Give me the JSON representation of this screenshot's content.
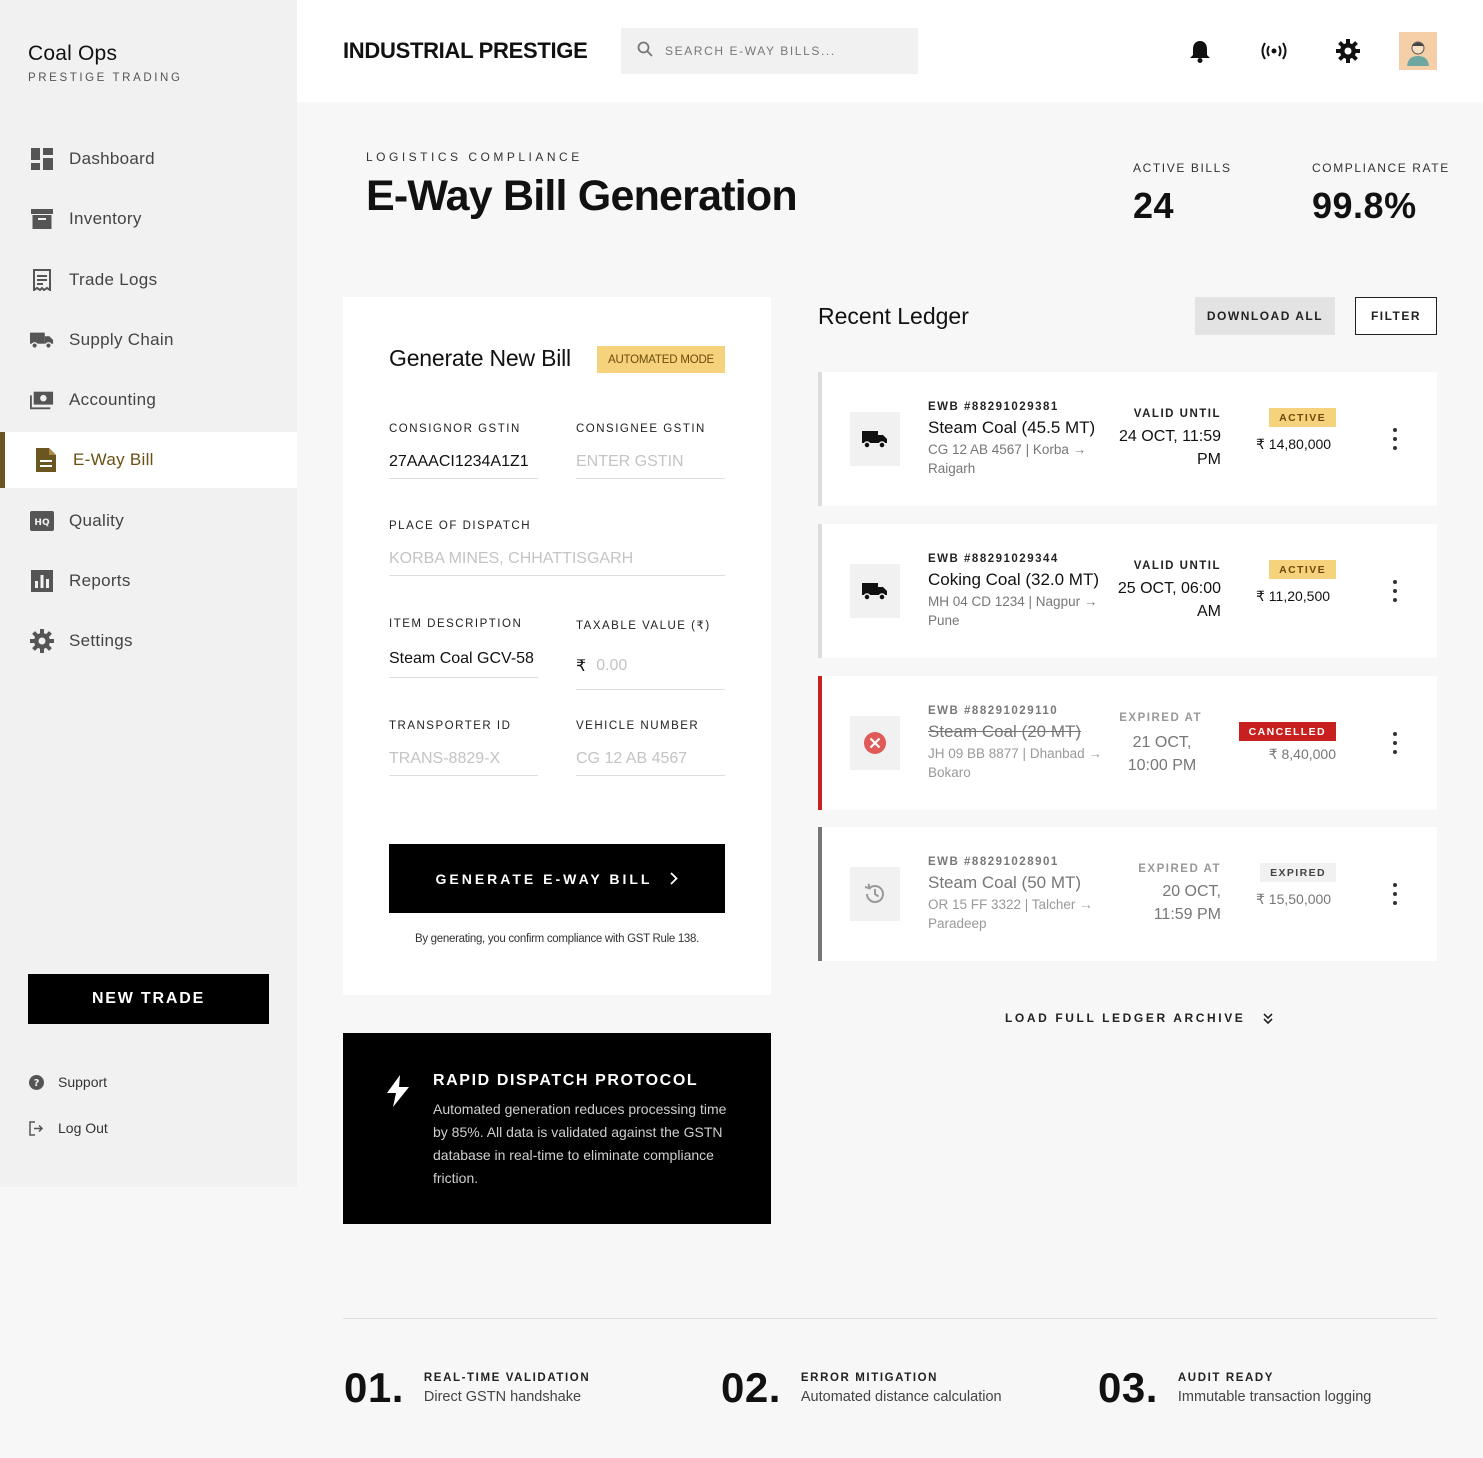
{
  "sidebar": {
    "brand_name": "Coal Ops",
    "brand_sub": "PRESTIGE TRADING",
    "items": [
      {
        "label": "Dashboard",
        "icon": "dashboard-icon"
      },
      {
        "label": "Inventory",
        "icon": "archive-icon"
      },
      {
        "label": "Trade Logs",
        "icon": "receipt-icon"
      },
      {
        "label": "Supply Chain",
        "icon": "truck-icon"
      },
      {
        "label": "Accounting",
        "icon": "cash-icon"
      },
      {
        "label": "E-Way Bill",
        "icon": "document-icon",
        "active": true
      },
      {
        "label": "Quality",
        "icon": "hq-icon"
      },
      {
        "label": "Reports",
        "icon": "bar-chart-icon"
      },
      {
        "label": "Settings",
        "icon": "gear-icon"
      }
    ],
    "new_trade": "NEW TRADE",
    "support": "Support",
    "logout": "Log Out"
  },
  "header": {
    "title": "INDUSTRIAL PRESTIGE",
    "search_placeholder": "SEARCH E-WAY BILLS..."
  },
  "page": {
    "eyebrow": "LOGISTICS COMPLIANCE",
    "title": "E-Way Bill Generation",
    "stats": [
      {
        "label": "ACTIVE BILLS",
        "value": "24"
      },
      {
        "label": "COMPLIANCE RATE",
        "value": "99.8%"
      }
    ]
  },
  "form": {
    "title": "Generate New Bill",
    "mode_badge": "AUTOMATED MODE",
    "consignor_label": "CONSIGNOR GSTIN",
    "consignor_value": "27AAACI1234A1Z1",
    "consignee_label": "CONSIGNEE GSTIN",
    "consignee_placeholder": "ENTER GSTIN",
    "dispatch_label": "PLACE OF DISPATCH",
    "dispatch_placeholder": "KORBA MINES, CHHATTISGARH",
    "item_label": "ITEM DESCRIPTION",
    "item_value": "Steam Coal GCV-58",
    "taxable_label": "TAXABLE VALUE (₹)",
    "taxable_symbol": "₹",
    "taxable_placeholder": "0.00",
    "transporter_label": "TRANSPORTER ID",
    "transporter_placeholder": "TRANS-8829-X",
    "vehicle_label": "VEHICLE NUMBER",
    "vehicle_placeholder": "CG 12 AB 4567",
    "generate_label": "GENERATE E-WAY BILL",
    "fine_print": "By generating, you confirm compliance with GST Rule 138."
  },
  "protocol": {
    "title": "RAPID DISPATCH PROTOCOL",
    "body": "Automated generation reduces processing time by 85%. All data is validated against the GSTN database in real-time to eliminate compliance friction."
  },
  "ledger": {
    "title": "Recent Ledger",
    "download_all": "DOWNLOAD ALL",
    "filter": "FILTER",
    "rows": [
      {
        "ewb": "EWB #88291029381",
        "item": "Steam Coal (45.5 MT)",
        "route": "CG 12 AB 4567 | Korba → Raigarh",
        "time_label": "VALID UNTIL",
        "time": "24 OCT, 11:59 PM",
        "status": "ACTIVE",
        "amount": "₹ 14,80,000",
        "icon": "truck-icon"
      },
      {
        "ewb": "EWB #88291029344",
        "item": "Coking Coal (32.0 MT)",
        "route": "MH 04 CD 1234 | Nagpur → Pune",
        "time_label": "VALID UNTIL",
        "time": "25 OCT, 06:00 AM",
        "status": "ACTIVE",
        "amount": "₹ 11,20,500",
        "icon": "truck-icon"
      },
      {
        "ewb": "EWB #88291029110",
        "item": "Steam Coal (20 MT)",
        "route": "JH 09 BB 8877 | Dhanbad → Bokaro",
        "time_label": "EXPIRED AT",
        "time": "21 OCT, 10:00 PM",
        "status": "CANCELLED",
        "amount": "₹ 8,40,000",
        "icon": "cancel-circle-icon"
      },
      {
        "ewb": "EWB #88291028901",
        "item": "Steam Coal (50 MT)",
        "route": "OR 15 FF 3322 | Talcher → Paradeep",
        "time_label": "EXPIRED AT",
        "time": "20 OCT, 11:59 PM",
        "status": "EXPIRED",
        "amount": "₹ 15,50,000",
        "icon": "history-icon"
      }
    ],
    "load_more": "LOAD FULL LEDGER ARCHIVE"
  },
  "features": [
    {
      "num": "01.",
      "title": "REAL-TIME VALIDATION",
      "desc": "Direct GSTN handshake"
    },
    {
      "num": "02.",
      "title": "ERROR MITIGATION",
      "desc": "Automated distance calculation"
    },
    {
      "num": "03.",
      "title": "AUDIT READY",
      "desc": "Immutable transaction logging"
    }
  ],
  "colors": {
    "accent_gold": "#f7d27c",
    "active_nav": "#6b5520",
    "cancelled_red": "#c8201e"
  }
}
